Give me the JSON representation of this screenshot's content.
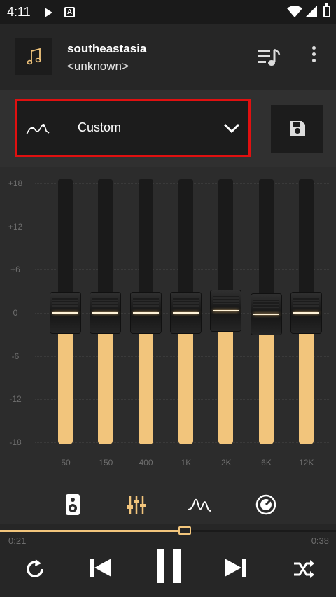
{
  "status_bar": {
    "time": "4:11"
  },
  "header": {
    "title": "southeastasia",
    "artist": "<unknown>"
  },
  "preset": {
    "name": "Custom"
  },
  "eq": {
    "db_labels": [
      "+18",
      "+12",
      "+6",
      "0",
      "-6",
      "-12",
      "-18"
    ],
    "bands": [
      {
        "freq": "50",
        "gain_db": 0
      },
      {
        "freq": "150",
        "gain_db": 0
      },
      {
        "freq": "400",
        "gain_db": 0
      },
      {
        "freq": "1K",
        "gain_db": 0
      },
      {
        "freq": "2K",
        "gain_db": 0.3
      },
      {
        "freq": "6K",
        "gain_db": -0.2
      },
      {
        "freq": "12K",
        "gain_db": 0
      }
    ],
    "accent_color": "#f2c57c"
  },
  "tabs": [
    {
      "icon": "speaker-icon"
    },
    {
      "icon": "equalizer-icon"
    },
    {
      "icon": "waveform-icon"
    },
    {
      "icon": "volume-knob-icon"
    }
  ],
  "playback": {
    "current_time": "0:21",
    "total_time": "0:38",
    "progress": 0.55
  },
  "colors": {
    "highlight_border": "#e01010",
    "background": "#2c2c2c"
  }
}
